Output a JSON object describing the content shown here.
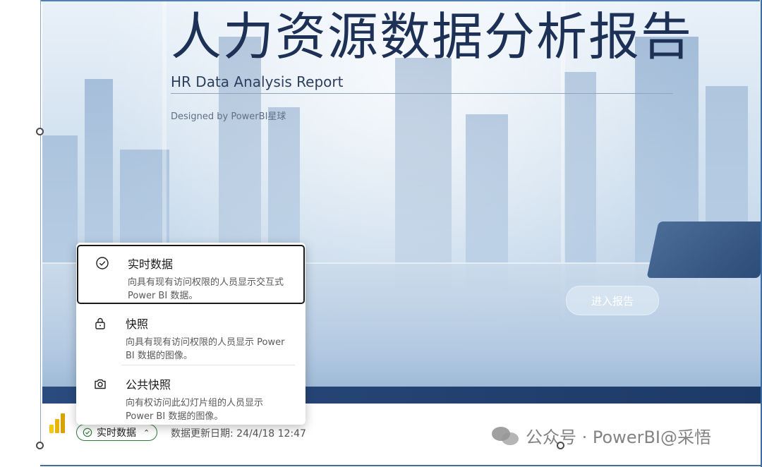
{
  "slide": {
    "title": "人力资源数据分析报告",
    "subtitle": "HR Data Analysis Report",
    "designed_by": "Designed by PowerBI星球",
    "enter_button": "进入报告"
  },
  "dropdown": {
    "items": [
      {
        "title": "实时数据",
        "description": "向具有现有访问权限的人员显示交互式 Power BI 数据。",
        "icon": "check-circle-icon",
        "selected": true
      },
      {
        "title": "快照",
        "description": "向具有现有访问权限的人员显示 Power BI 数据的图像。",
        "icon": "lock-icon",
        "selected": false
      },
      {
        "title": "公共快照",
        "description": "向有权访问此幻灯片组的人员显示 Power BI 数据的图像。",
        "icon": "camera-icon",
        "selected": false
      }
    ]
  },
  "statusbar": {
    "mode_label": "实时数据",
    "update_text": "数据更新日期: 24/4/18 12:47"
  },
  "watermark": {
    "text": "公众号 · PowerBI@采悟"
  },
  "colors": {
    "title": "#1d3157",
    "frame": "#3d6ea6",
    "pill_border": "#2f7a3b",
    "band": "#1d3a66"
  }
}
